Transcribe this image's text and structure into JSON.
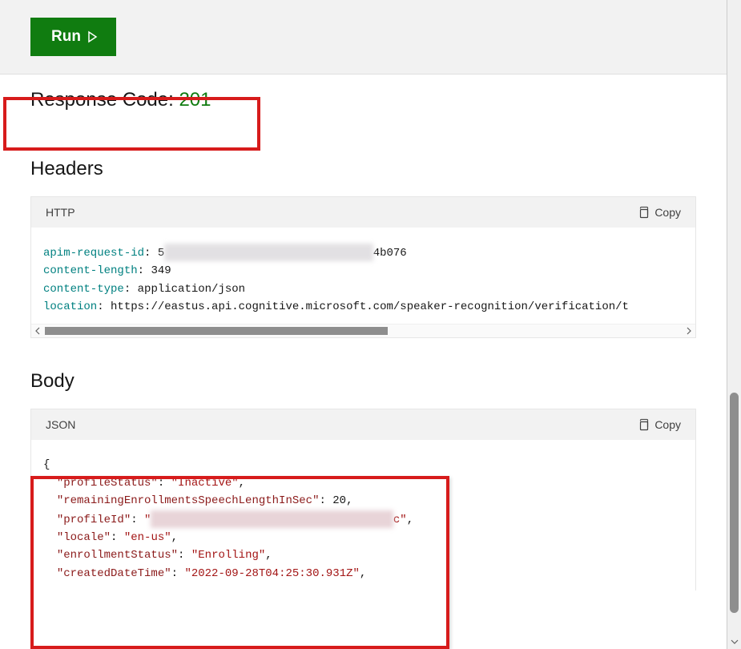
{
  "topbar": {
    "run_label": "Run"
  },
  "response": {
    "label": "Response Code: ",
    "code": "201"
  },
  "headers_section": {
    "heading": "Headers",
    "lang": "HTTP",
    "copy_label": "Copy",
    "rows": {
      "apim_request_id_key": "apim-request-id",
      "apim_request_id_prefix": "5",
      "apim_request_id_obscured": "███████████████████████████████",
      "apim_request_id_suffix": "4b076",
      "content_length_key": "content-length",
      "content_length_val": "349",
      "content_type_key": "content-type",
      "content_type_val": "application/json",
      "location_key": "location",
      "location_val": "https://eastus.api.cognitive.microsoft.com/speaker-recognition/verification/t"
    }
  },
  "body_section": {
    "heading": "Body",
    "lang": "JSON",
    "copy_label": "Copy",
    "json": {
      "profileStatus_key": "\"profileStatus\"",
      "profileStatus_val": "\"Inactive\"",
      "remainingEnrollmentsSpeechLengthInSec_key": "\"remainingEnrollmentsSpeechLengthInSec\"",
      "remainingEnrollmentsSpeechLengthInSec_val": "20",
      "profileId_key": "\"profileId\"",
      "profileId_val_prefix": "\"",
      "profileId_obscured": "████████████████████████████████████",
      "profileId_val_suffix": "c\"",
      "locale_key": "\"locale\"",
      "locale_val": "\"en-us\"",
      "enrollmentStatus_key": "\"enrollmentStatus\"",
      "enrollmentStatus_val": "\"Enrolling\"",
      "createdDateTime_key": "\"createdDateTime\"",
      "createdDateTime_val": "\"2022-09-28T04:25:30.931Z\""
    }
  }
}
